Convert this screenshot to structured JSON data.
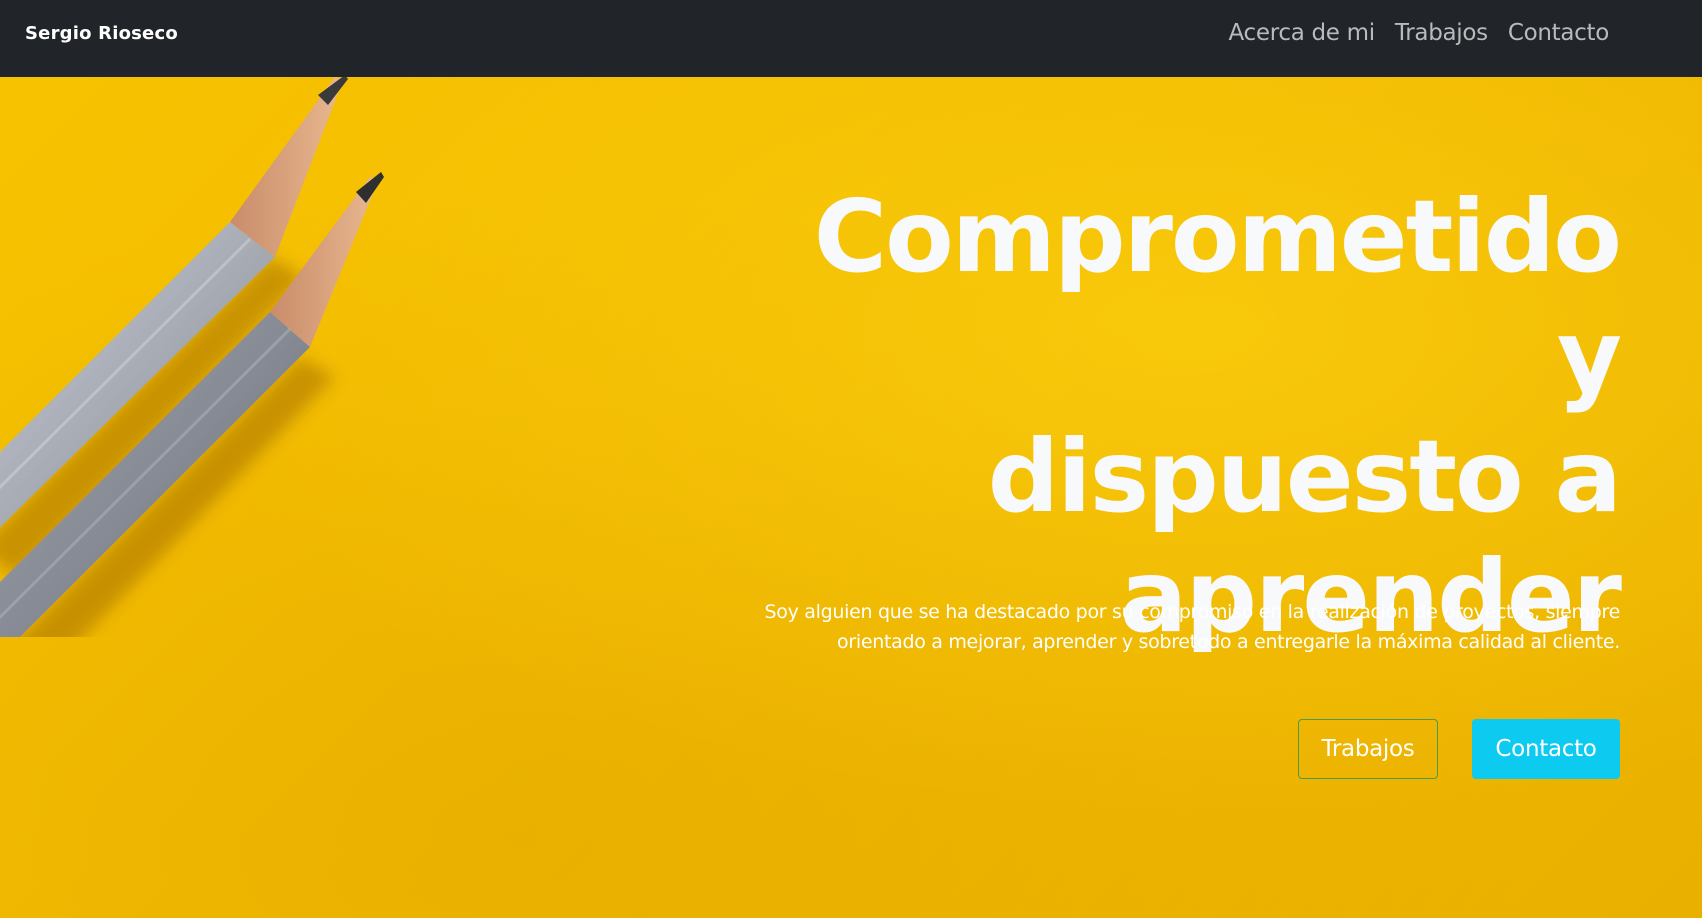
{
  "navbar": {
    "brand": "Sergio Rioseco",
    "links": [
      {
        "label": "Acerca de mi"
      },
      {
        "label": "Trabajos"
      },
      {
        "label": "Contacto"
      }
    ]
  },
  "hero": {
    "headline_lines": [
      "Comprometido y",
      "dispuesto a",
      "aprender"
    ],
    "lead_lines": [
      "Soy alguien que se ha destacado por su compromiso en la realización de proyectos, siempre",
      "orientado a mejorar, aprender y sobretodo a entregarle la máxima calidad al cliente."
    ],
    "buttons": {
      "secondary_label": "Trabajos",
      "primary_label": "Contacto"
    },
    "background_image": "yellow-paper-with-two-pencils"
  },
  "colors": {
    "navbar_bg": "#212529",
    "hero_bg": "#f1b800",
    "primary_button": "#0dcaf0",
    "outline_border": "#4f9a4f",
    "nav_link": "#b9babc"
  }
}
